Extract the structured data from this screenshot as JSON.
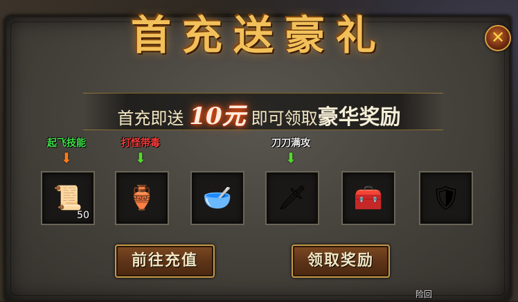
{
  "dialog": {
    "title": "首充送豪礼",
    "close_glyph": "✕",
    "promo": {
      "prefix": "首充即送",
      "amount": "10元",
      "middle": "即可领取",
      "emphasis": "豪华奖励"
    },
    "slots": [
      {
        "label": "起飞技能",
        "label_color": "#3fe04a",
        "arrow": "⬇",
        "arrow_color": "#ff7a18",
        "icon_name": "scroll-icon",
        "glyph": "📜",
        "count": "50"
      },
      {
        "label": "打怪带毒",
        "label_color": "#ff3b3b",
        "arrow": "⬇",
        "arrow_color": "#56d82e",
        "icon_name": "potion-vase-icon",
        "glyph": "🏺",
        "count": ""
      },
      {
        "label": "",
        "label_color": "#ffffff",
        "arrow": "",
        "arrow_color": "#56d82e",
        "icon_name": "bowl-icon",
        "glyph": "🥣",
        "count": ""
      },
      {
        "label": "刀刀满攻",
        "label_color": "#f0f0f0",
        "arrow": "⬇",
        "arrow_color": "#56d82e",
        "icon_name": "sword-icon",
        "glyph": "🗡",
        "count": ""
      },
      {
        "label": "",
        "label_color": "#ffffff",
        "arrow": "",
        "arrow_color": "#56d82e",
        "icon_name": "treasure-chest-icon",
        "glyph": "🧰",
        "count": ""
      },
      {
        "label": "",
        "label_color": "#ffffff",
        "arrow": "",
        "arrow_color": "#56d82e",
        "icon_name": "armor-icon",
        "glyph": "🛡",
        "count": ""
      }
    ],
    "buttons": {
      "recharge": "前往充值",
      "claim": "领取奖励"
    }
  },
  "footer": {
    "partial_text": "险回"
  }
}
